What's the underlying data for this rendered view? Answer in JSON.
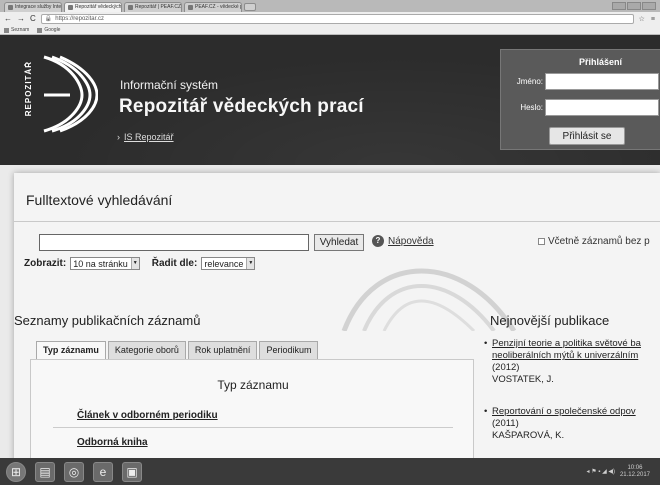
{
  "browser": {
    "tabs": [
      {
        "label": "Integrace služby Internet..."
      },
      {
        "label": "Repozitář vědeckých prací"
      },
      {
        "label": "Repozitář | PEAF.CZ"
      },
      {
        "label": "PEAF.CZ - vědecké práce"
      }
    ],
    "url": "https://repozitar.cz",
    "bookmarks": [
      {
        "label": "Seznam"
      },
      {
        "label": "Google"
      }
    ]
  },
  "header": {
    "logo_text": "REPOZITÁŘ",
    "system_label": "Informační systém",
    "title": "Repozitář vědeckých prací",
    "breadcrumb_link": "IS Repozitář"
  },
  "login": {
    "title": "Přihlášení",
    "username_label": "Jméno:",
    "password_label": "Heslo:",
    "button": "Přihlásit se"
  },
  "search": {
    "section_title": "Fulltextové vyhledávání",
    "query": "",
    "button": "Vyhledat",
    "help_link": "Nápověda",
    "include_label": "Včetně záznamů bez p",
    "show_label": "Zobrazit:",
    "show_value": "10 na stránku",
    "sort_label": "Řadit dle:",
    "sort_value": "relevance"
  },
  "lists": {
    "title": "Seznamy publikačních záznamů",
    "tabs": [
      "Typ záznamu",
      "Kategorie oborů",
      "Rok uplatnění",
      "Periodikum"
    ],
    "panel_title": "Typ záznamu",
    "items": [
      "Článek v odborném periodiku",
      "Odborná kniha"
    ]
  },
  "newest": {
    "title": "Nejnovější publikace",
    "items": [
      {
        "title_line1": "Penzijní teorie a politika světové ba",
        "title_line2": "neoliberálních mýtů k univerzálním",
        "year": "(2012)",
        "author": "VOSTATEK, J."
      },
      {
        "title_line1": "Reportování o společenské odpov",
        "year": "(2011)",
        "author": "KAŠPAROVÁ, K."
      }
    ]
  },
  "taskbar": {
    "clock_time": "10:06",
    "clock_date": "21.12.2017"
  }
}
